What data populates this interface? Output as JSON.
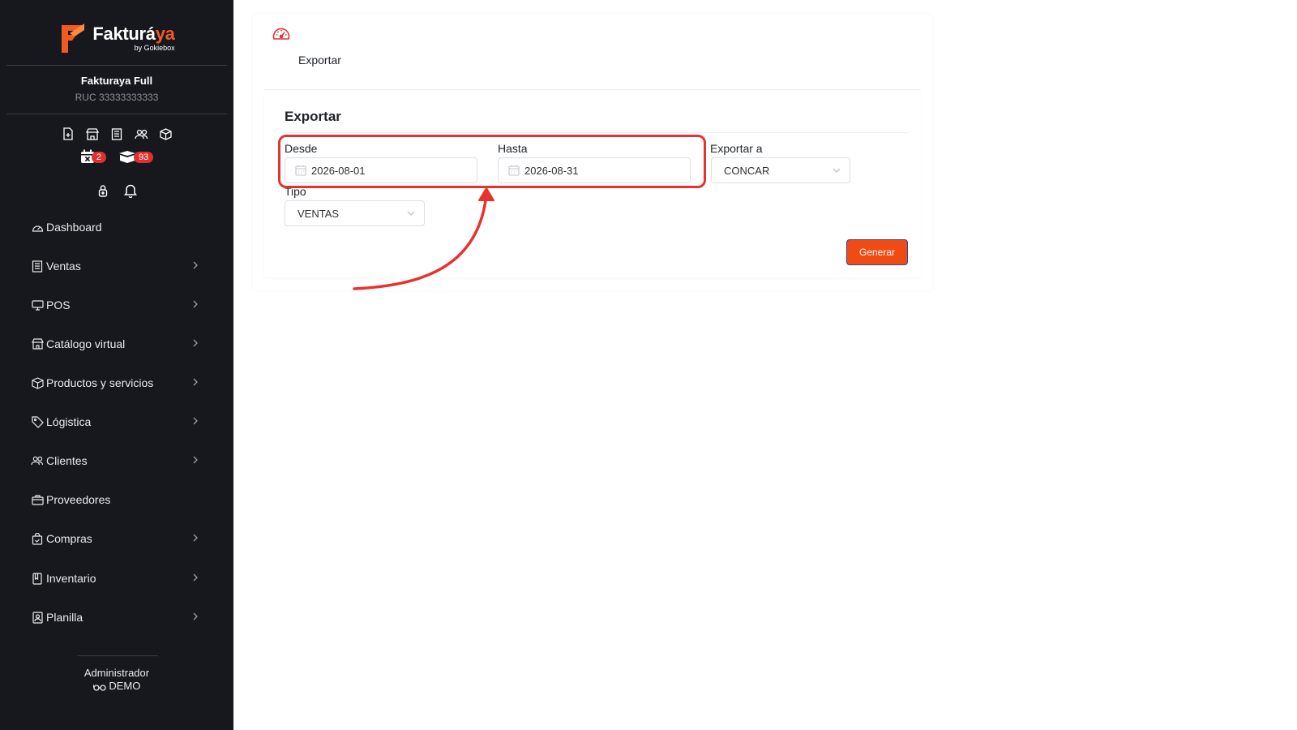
{
  "brand": {
    "name_part1": "Fakturá",
    "name_part2": "ya",
    "sub": "by Gokiebox",
    "accent": "#f15a24"
  },
  "company": {
    "name": "Fakturaya Full",
    "ruc": "RUC 33333333333"
  },
  "quick_icons": [
    "new-document-icon",
    "store-icon",
    "receipt-list-icon",
    "users-icon",
    "box-icon"
  ],
  "badges": {
    "calendar_count": "2",
    "boxes_count": "93"
  },
  "user_icons": [
    "lock-icon",
    "bell-icon"
  ],
  "sidebar": {
    "items": [
      {
        "label": "Dashboard",
        "icon": "dashboard-icon",
        "has_chevron": false
      },
      {
        "label": "Ventas",
        "icon": "ventas-icon",
        "has_chevron": true
      },
      {
        "label": "POS",
        "icon": "monitor-icon",
        "has_chevron": true
      },
      {
        "label": "Catálogo virtual",
        "icon": "store-icon",
        "has_chevron": true
      },
      {
        "label": "Productos y servicios",
        "icon": "box-icon",
        "has_chevron": true
      },
      {
        "label": "Lógistica",
        "icon": "tag-icon",
        "has_chevron": true
      },
      {
        "label": "Clientes",
        "icon": "users-icon",
        "has_chevron": true
      },
      {
        "label": "Proveedores",
        "icon": "briefcase-icon",
        "has_chevron": false
      },
      {
        "label": "Compras",
        "icon": "shopping-bag-icon",
        "has_chevron": true
      },
      {
        "label": "Inventario",
        "icon": "book-icon",
        "has_chevron": true
      },
      {
        "label": "Planilla",
        "icon": "id-card-icon",
        "has_chevron": true
      }
    ],
    "footer_role": "Administrador",
    "footer_user": "DEMO"
  },
  "page": {
    "breadcrumb": "Exportar",
    "form_title": "Exportar"
  },
  "form": {
    "desde_label": "Desde",
    "desde_value": "2026-08-01",
    "hasta_label": "Hasta",
    "hasta_value": "2026-08-31",
    "exportar_label": "Exportar a",
    "exportar_value": "CONCAR",
    "tipo_label": "Tipo",
    "tipo_value": "VENTAS",
    "submit_label": "Generar"
  },
  "colors": {
    "sidebar_bg": "#16181d",
    "button": "#f04b14",
    "annotation": "#e8322f"
  }
}
